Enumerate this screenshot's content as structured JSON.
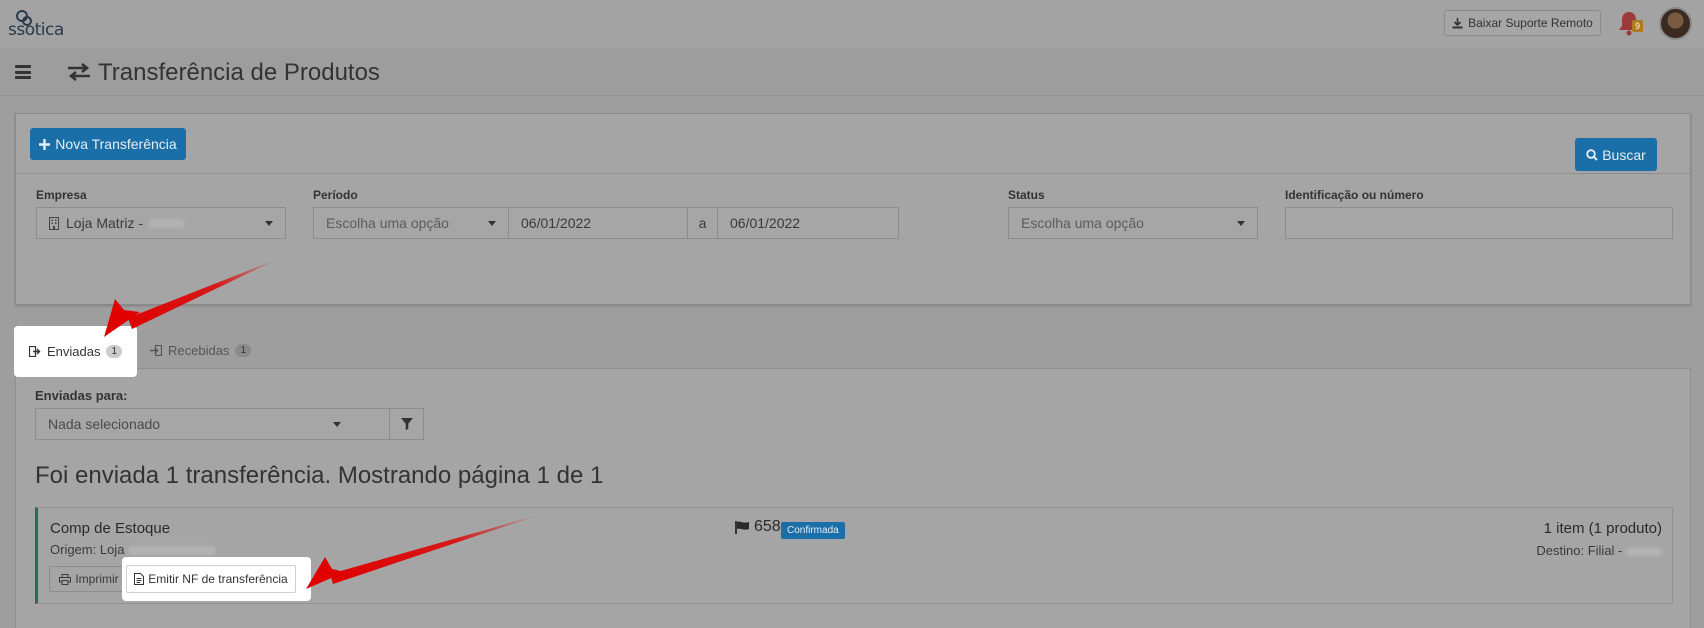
{
  "app": {
    "logo_text": "ssotica"
  },
  "topbar": {
    "remote_support_label": "Baixar Suporte Remoto",
    "notifications_count": "9"
  },
  "header": {
    "title": "Transferência de Produtos"
  },
  "filters": {
    "new_button_label": "Nova Transferência",
    "empresa": {
      "label": "Empresa",
      "value": "Loja Matriz -"
    },
    "periodo": {
      "label": "Período",
      "select_value": "Escolha uma opção",
      "date_from": "06/01/2022",
      "separator": "a",
      "date_to": "06/01/2022"
    },
    "status": {
      "label": "Status",
      "value": "Escolha uma opção"
    },
    "identificacao": {
      "label": "Identificação ou número",
      "value": ""
    },
    "search_button_label": "Buscar"
  },
  "tabs": [
    {
      "label": "Enviadas",
      "count": "1",
      "active": true
    },
    {
      "label": "Recebidas",
      "count": "1",
      "active": false
    }
  ],
  "sent": {
    "to_label": "Enviadas para:",
    "to_value": "Nada selecionado",
    "summary": "Foi enviada 1 transferência. Mostrando página 1 de 1"
  },
  "transfer": {
    "title": "Comp de Estoque",
    "origin_label": "Origem: Loja",
    "number": "658",
    "status": "Confirmada",
    "items": "1 item (1 produto)",
    "destination_label": "Destino: Filial -",
    "print_label": "Imprimir",
    "nf_label": "Emitir NF de transferência"
  },
  "colors": {
    "primary": "#1a6fa8",
    "highlight": "#ffffff",
    "arrow": "#e00000",
    "card_border_accent": "#1e6e5a"
  }
}
